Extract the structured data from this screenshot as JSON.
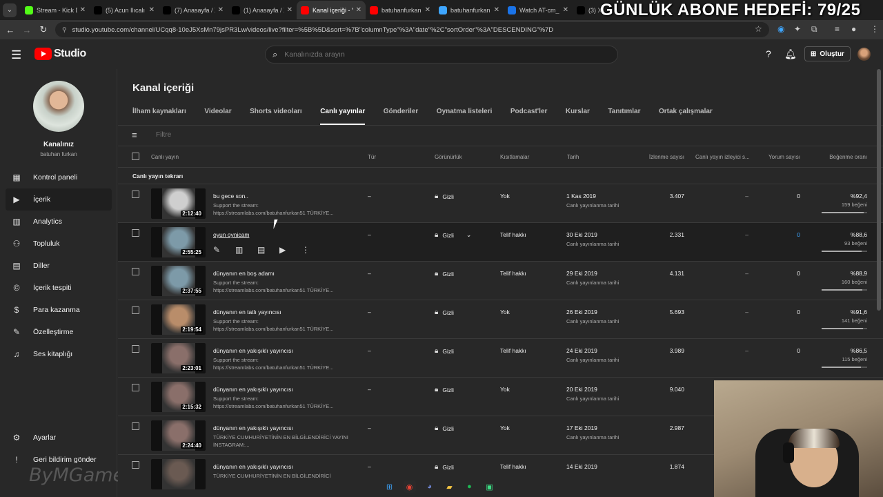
{
  "browser": {
    "tabs": [
      {
        "label": "Stream - Kick D",
        "color": "#53fc18",
        "active": false
      },
      {
        "label": "(5) Acun Ilıcalı",
        "color": "#000000",
        "active": false
      },
      {
        "label": "(7) Anasayfa / X",
        "color": "#000000",
        "active": false
      },
      {
        "label": "(1) Anasayfa / X",
        "color": "#000000",
        "active": false
      },
      {
        "label": "Kanal içeriği - Y",
        "color": "#ff0000",
        "active": true
      },
      {
        "label": "batuhanfurkan",
        "color": "#ff0000",
        "active": false
      },
      {
        "label": "batuhanfurkan",
        "color": "#3ea6ff",
        "active": false
      },
      {
        "label": "Watch AT-cm_",
        "color": "#1a73e8",
        "active": false
      },
      {
        "label": "(3) X",
        "color": "#000000",
        "active": false
      }
    ],
    "url": "studio.youtube.com/channel/UCqq8-10eJ5XsMn79jsPR3Lw/videos/live?filter=%5B%5D&sort=%7B\"columnType\"%3A\"date\"%2C\"sortOrder\"%3A\"DESCENDING\"%7D",
    "overlay_text": "GÜNLÜK ABONE HEDEFİ: 79/25"
  },
  "header": {
    "logo_text": "Studio",
    "search_placeholder": "Kanalınızda arayın",
    "create_label": "Oluştur"
  },
  "sidebar": {
    "channel_title": "Kanalınız",
    "channel_handle": "batuhan furkan",
    "items": [
      {
        "label": "Kontrol paneli",
        "icon": "dashboard-icon",
        "glyph": "▦",
        "active": false
      },
      {
        "label": "İçerik",
        "icon": "content-icon",
        "glyph": "▶",
        "active": true
      },
      {
        "label": "Analytics",
        "icon": "analytics-icon",
        "glyph": "▥",
        "active": false
      },
      {
        "label": "Topluluk",
        "icon": "community-icon",
        "glyph": "⚇",
        "active": false
      },
      {
        "label": "Diller",
        "icon": "subtitles-icon",
        "glyph": "▤",
        "active": false
      },
      {
        "label": "İçerik tespiti",
        "icon": "copyright-icon",
        "glyph": "©",
        "active": false
      },
      {
        "label": "Para kazanma",
        "icon": "monetization-icon",
        "glyph": "$",
        "active": false
      },
      {
        "label": "Özelleştirme",
        "icon": "customization-icon",
        "glyph": "✎",
        "active": false
      },
      {
        "label": "Ses kitaplığı",
        "icon": "audio-library-icon",
        "glyph": "♫",
        "active": false
      }
    ],
    "bottom_items": [
      {
        "label": "Ayarlar",
        "icon": "settings-icon",
        "glyph": "⚙"
      },
      {
        "label": "Geri bildirim gönder",
        "icon": "feedback-icon",
        "glyph": "!"
      }
    ],
    "watermark": "ByMGame"
  },
  "main": {
    "page_title": "Kanal içeriği",
    "tabs": [
      "İlham kaynakları",
      "Videolar",
      "Shorts videoları",
      "Canlı yayınlar",
      "Gönderiler",
      "Oynatma listeleri",
      "Podcast'ler",
      "Kurslar",
      "Tanıtımlar",
      "Ortak çalışmalar"
    ],
    "active_tab": "Canlı yayınlar",
    "filter_placeholder": "Filtre",
    "columns": {
      "stream": "Canlı yayın",
      "type": "Tür",
      "visibility": "Görünürlük",
      "restrictions": "Kısıtlamalar",
      "date": "Tarih",
      "views": "İzlenme sayısı",
      "concurrent": "Canlı yayın izleyici s...",
      "comments": "Yorum sayısı",
      "like_ratio": "Beğenme oranı"
    },
    "section_label": "Canlı yayın tekrarı",
    "rows": [
      {
        "title": "bu gece son..",
        "desc": "Support the stream: https://streamlabs.com/batuhanfurkan51 TÜRKİYE...",
        "duration": "2:12:40",
        "type": "–",
        "visibility": "Gizli",
        "restriction": "Yok",
        "date": "1 Kas 2019",
        "date_sub": "Canlı yayınlanma tarihi",
        "views": "3.407",
        "concurrent": "–",
        "comments": "0",
        "ratio": "%92,4",
        "likes": "159 beğeni",
        "ratio_value": 0.924,
        "hover": false,
        "thumb_color": "#cfcfcf"
      },
      {
        "title": "oyun oynicam",
        "desc": "",
        "duration": "2:55:25",
        "type": "–",
        "visibility": "Gizli",
        "restriction": "Telif hakkı",
        "date": "30 Eki 2019",
        "date_sub": "Canlı yayınlanma tarihi",
        "views": "2.331",
        "concurrent": "–",
        "comments": "0",
        "ratio": "%88,6",
        "likes": "93 beğeni",
        "ratio_value": 0.886,
        "hover": true,
        "thumb_color": "#7d9aa8"
      },
      {
        "title": "dünyanın en boş adamı",
        "desc": "Support the stream: https://streamlabs.com/batuhanfurkan51 TÜRKİYE...",
        "duration": "2:37:55",
        "type": "–",
        "visibility": "Gizli",
        "restriction": "Telif hakkı",
        "date": "29 Eki 2019",
        "date_sub": "Canlı yayınlanma tarihi",
        "views": "4.131",
        "concurrent": "–",
        "comments": "0",
        "ratio": "%88,9",
        "likes": "160 beğeni",
        "ratio_value": 0.889,
        "hover": false,
        "thumb_color": "#7d9aa8"
      },
      {
        "title": "dünyanın en tatlı yayıncısı",
        "desc": "Support the stream: https://streamlabs.com/batuhanfurkan51 TÜRKİYE...",
        "duration": "2:19:54",
        "type": "–",
        "visibility": "Gizli",
        "restriction": "Yok",
        "date": "26 Eki 2019",
        "date_sub": "Canlı yayınlanma tarihi",
        "views": "5.693",
        "concurrent": "–",
        "comments": "0",
        "ratio": "%91,6",
        "likes": "141 beğeni",
        "ratio_value": 0.916,
        "hover": false,
        "thumb_color": "#b98d6a"
      },
      {
        "title": "dünyanın en yakışıklı yayıncısı",
        "desc": "Support the stream: https://streamlabs.com/batuhanfurkan51 TÜRKİYE...",
        "duration": "2:23:01",
        "type": "–",
        "visibility": "Gizli",
        "restriction": "Telif hakkı",
        "date": "24 Eki 2019",
        "date_sub": "Canlı yayınlanma tarihi",
        "views": "3.989",
        "concurrent": "–",
        "comments": "0",
        "ratio": "%86,5",
        "likes": "115 beğeni",
        "ratio_value": 0.865,
        "hover": false,
        "thumb_color": "#8a6f6a"
      },
      {
        "title": "dünyanın en yakışıklı yayıncısı",
        "desc": "Support the stream: https://streamlabs.com/batuhanfurkan51 TÜRKİYE...",
        "duration": "2:15:32",
        "type": "–",
        "visibility": "Gizli",
        "restriction": "Yok",
        "date": "20 Eki 2019",
        "date_sub": "Canlı yayınlanma tarihi",
        "views": "9.040",
        "concurrent": "",
        "comments": "",
        "ratio": "",
        "likes": "",
        "ratio_value": null,
        "hover": false,
        "thumb_color": "#8a6f6a"
      },
      {
        "title": "dünyanın en yakışıklı yayıncısı",
        "desc": "TÜRKİYE CUMHURİYETİNİN EN BİLGİLENDİRİCİ YAYINI İNSTAGRAM:...",
        "duration": "2:24:40",
        "type": "–",
        "visibility": "Gizli",
        "restriction": "Yok",
        "date": "17 Eki 2019",
        "date_sub": "Canlı yayınlanma tarihi",
        "views": "2.987",
        "concurrent": "",
        "comments": "",
        "ratio": "",
        "likes": "",
        "ratio_value": null,
        "hover": false,
        "thumb_color": "#8a6f6a"
      },
      {
        "title": "dünyanın en yakışıklı yayıncısı",
        "desc": "TÜRKİYE CUMHURİYETİNİN EN BİLGİLENDİRİCİ",
        "duration": "",
        "type": "–",
        "visibility": "Gizli",
        "restriction": "Telif hakkı",
        "date": "14 Eki 2019",
        "date_sub": "",
        "views": "1.874",
        "concurrent": "",
        "comments": "",
        "ratio": "",
        "likes": "",
        "ratio_value": null,
        "hover": false,
        "thumb_color": "#6a5a52"
      }
    ]
  }
}
